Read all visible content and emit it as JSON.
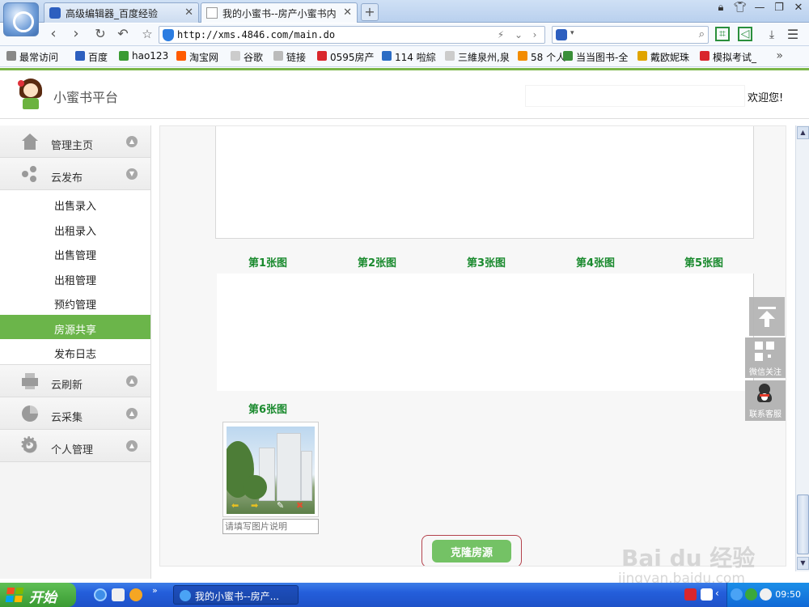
{
  "browser": {
    "tabs": [
      {
        "title": "高级编辑器_百度经验",
        "active": false
      },
      {
        "title": "我的小蜜书--房产小蜜书内",
        "active": true
      }
    ],
    "new_tab": "+",
    "url": "http://xms.4846.com/main.do",
    "bookmarks": [
      {
        "label": "最常访问",
        "color": "#888888"
      },
      {
        "label": "百度",
        "color": "#2d5fbf"
      },
      {
        "label": "hao123",
        "color": "#3a9b33"
      },
      {
        "label": "淘宝网",
        "color": "#ff5a00"
      },
      {
        "label": "谷歌",
        "color": "#cccccc"
      },
      {
        "label": "链接",
        "color": "#bbbbbb"
      },
      {
        "label": "0595房产",
        "color": "#d9262c"
      },
      {
        "label": "114 啦綜",
        "color": "#2b6cc4"
      },
      {
        "label": "三維泉州,泉",
        "color": "#cccccc"
      },
      {
        "label": "58 个人",
        "color": "#f28c00"
      },
      {
        "label": "当当图书-全",
        "color": "#3a8f3a"
      },
      {
        "label": "戴欧妮珠",
        "color": "#e0a400"
      },
      {
        "label": "模拟考试_",
        "color": "#d9262c"
      }
    ],
    "more": "»"
  },
  "app": {
    "title": "小蜜书平台",
    "welcome": "欢迎您!"
  },
  "sidebar": {
    "items": [
      {
        "label": "管理主页",
        "icon": "home-icon"
      },
      {
        "label": "云发布",
        "icon": "share-icon"
      },
      {
        "label": "云刷新",
        "icon": "printer-icon"
      },
      {
        "label": "云采集",
        "icon": "pie-chart-icon"
      },
      {
        "label": "个人管理",
        "icon": "gear-icon"
      }
    ],
    "subitems": [
      {
        "label": "出售录入"
      },
      {
        "label": "出租录入"
      },
      {
        "label": "出售管理"
      },
      {
        "label": "出租管理"
      },
      {
        "label": "预约管理"
      },
      {
        "label": "房源共享",
        "active": true
      },
      {
        "label": "发布日志"
      }
    ]
  },
  "main": {
    "image_labels": [
      "第1张图",
      "第2张图",
      "第3张图",
      "第4张图",
      "第5张图"
    ],
    "image6_label": "第6张图",
    "caption_placeholder": "请填写图片说明",
    "clone_button": "克隆房源"
  },
  "floating": {
    "wechat_label": "微信关注",
    "service_label": "联系客服"
  },
  "watermark": {
    "brand": "Bai du 经验",
    "url": "jingyan.baidu.com"
  },
  "taskbar": {
    "start": "开始",
    "task": "我的小蜜书--房产...",
    "clock": "09:50"
  },
  "colors": {
    "accent_green": "#6bb54a",
    "label_green": "#1a8a2e",
    "clone_border": "#b4424c"
  }
}
